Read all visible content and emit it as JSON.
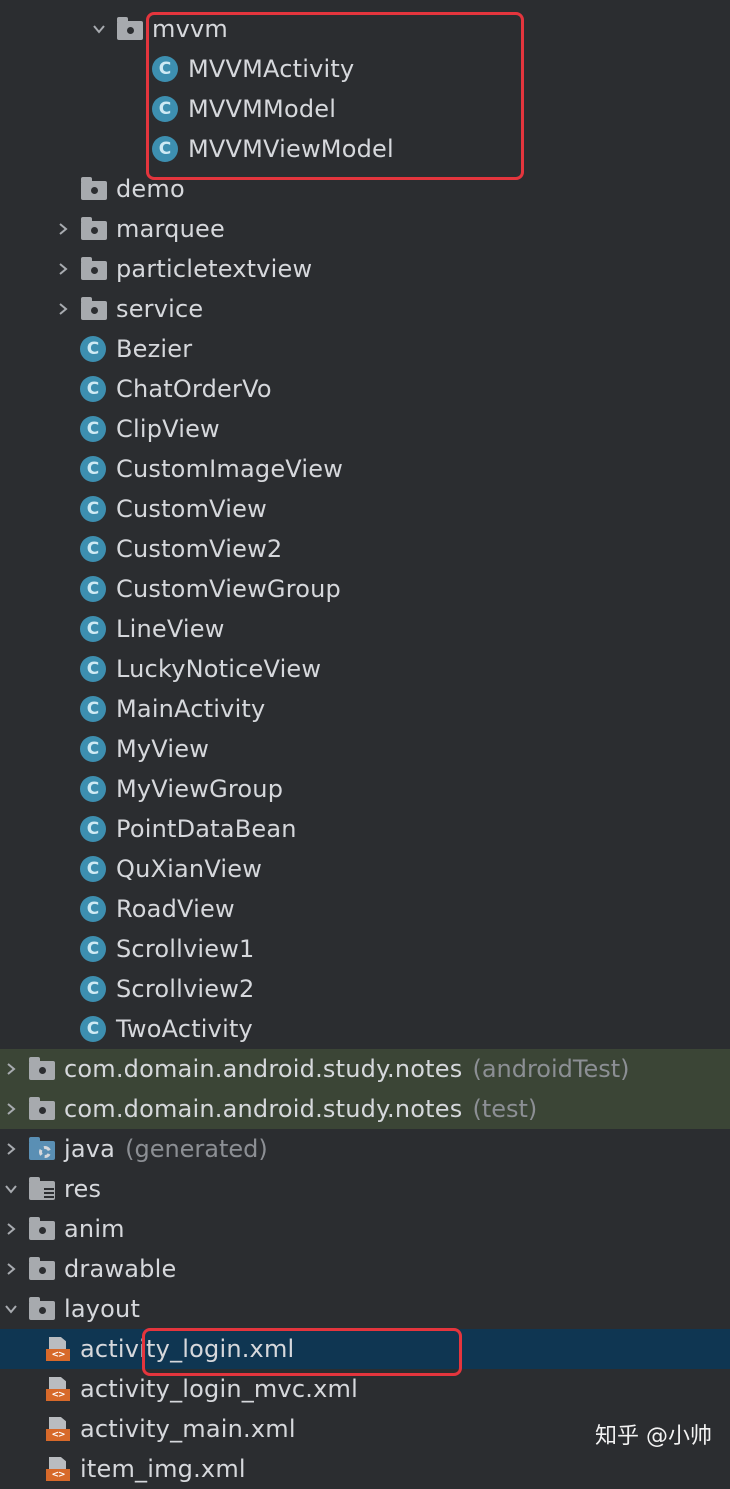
{
  "tree": {
    "rows": [
      {
        "label": "mvvm",
        "suffix": "",
        "icon": "folder",
        "arrow": "down",
        "depth": 6,
        "style": ""
      },
      {
        "label": "MVVMActivity",
        "suffix": "",
        "icon": "class",
        "arrow": "none",
        "depth": 7,
        "style": ""
      },
      {
        "label": "MVVMModel",
        "suffix": "",
        "icon": "class",
        "arrow": "none",
        "depth": 7,
        "style": ""
      },
      {
        "label": "MVVMViewModel",
        "suffix": "",
        "icon": "class",
        "arrow": "none",
        "depth": 7,
        "style": ""
      },
      {
        "label": "demo",
        "suffix": "",
        "icon": "folder",
        "arrow": "none",
        "depth": 5,
        "style": ""
      },
      {
        "label": "marquee",
        "suffix": "",
        "icon": "folder",
        "arrow": "right",
        "depth": 5,
        "style": ""
      },
      {
        "label": "particletextview",
        "suffix": "",
        "icon": "folder",
        "arrow": "right",
        "depth": 5,
        "style": ""
      },
      {
        "label": "service",
        "suffix": "",
        "icon": "folder",
        "arrow": "right",
        "depth": 5,
        "style": ""
      },
      {
        "label": "Bezier",
        "suffix": "",
        "icon": "class",
        "arrow": "none",
        "depth": 5,
        "style": ""
      },
      {
        "label": "ChatOrderVo",
        "suffix": "",
        "icon": "class",
        "arrow": "none",
        "depth": 5,
        "style": ""
      },
      {
        "label": "ClipView",
        "suffix": "",
        "icon": "class",
        "arrow": "none",
        "depth": 5,
        "style": ""
      },
      {
        "label": "CustomImageView",
        "suffix": "",
        "icon": "class",
        "arrow": "none",
        "depth": 5,
        "style": ""
      },
      {
        "label": "CustomView",
        "suffix": "",
        "icon": "class",
        "arrow": "none",
        "depth": 5,
        "style": ""
      },
      {
        "label": "CustomView2",
        "suffix": "",
        "icon": "class",
        "arrow": "none",
        "depth": 5,
        "style": ""
      },
      {
        "label": "CustomViewGroup",
        "suffix": "",
        "icon": "class",
        "arrow": "none",
        "depth": 5,
        "style": ""
      },
      {
        "label": "LineView",
        "suffix": "",
        "icon": "class",
        "arrow": "none",
        "depth": 5,
        "style": ""
      },
      {
        "label": "LuckyNoticeView",
        "suffix": "",
        "icon": "class",
        "arrow": "none",
        "depth": 5,
        "style": ""
      },
      {
        "label": "MainActivity",
        "suffix": "",
        "icon": "class",
        "arrow": "none",
        "depth": 5,
        "style": ""
      },
      {
        "label": "MyView",
        "suffix": "",
        "icon": "class",
        "arrow": "none",
        "depth": 5,
        "style": ""
      },
      {
        "label": "MyViewGroup",
        "suffix": "",
        "icon": "class",
        "arrow": "none",
        "depth": 5,
        "style": ""
      },
      {
        "label": "PointDataBean",
        "suffix": "",
        "icon": "class",
        "arrow": "none",
        "depth": 5,
        "style": ""
      },
      {
        "label": "QuXianView",
        "suffix": "",
        "icon": "class",
        "arrow": "none",
        "depth": 5,
        "style": ""
      },
      {
        "label": "RoadView",
        "suffix": "",
        "icon": "class",
        "arrow": "none",
        "depth": 5,
        "style": ""
      },
      {
        "label": "Scrollview1",
        "suffix": "",
        "icon": "class",
        "arrow": "none",
        "depth": 5,
        "style": ""
      },
      {
        "label": "Scrollview2",
        "suffix": "",
        "icon": "class",
        "arrow": "none",
        "depth": 5,
        "style": ""
      },
      {
        "label": "TwoActivity",
        "suffix": "",
        "icon": "class",
        "arrow": "none",
        "depth": 5,
        "style": ""
      },
      {
        "label": "com.domain.android.study.notes",
        "suffix": "(androidTest)",
        "icon": "folder",
        "arrow": "right",
        "depth": 3,
        "style": "green"
      },
      {
        "label": "com.domain.android.study.notes",
        "suffix": "(test)",
        "icon": "folder",
        "arrow": "right",
        "depth": 3,
        "style": "green"
      },
      {
        "label": "java",
        "suffix": "(generated)",
        "icon": "genfolder",
        "arrow": "right",
        "depth": 2,
        "style": ""
      },
      {
        "label": "res",
        "suffix": "",
        "icon": "resfolder",
        "arrow": "down",
        "depth": 2,
        "style": ""
      },
      {
        "label": "anim",
        "suffix": "",
        "icon": "folder",
        "arrow": "right",
        "depth": 3,
        "style": ""
      },
      {
        "label": "drawable",
        "suffix": "",
        "icon": "folder",
        "arrow": "right",
        "depth": 3,
        "style": ""
      },
      {
        "label": "layout",
        "suffix": "",
        "icon": "folder",
        "arrow": "down",
        "depth": 3,
        "style": ""
      },
      {
        "label": "activity_login.xml",
        "suffix": "",
        "icon": "xml",
        "arrow": "none",
        "depth": 4,
        "style": "selected"
      },
      {
        "label": "activity_login_mvc.xml",
        "suffix": "",
        "icon": "xml",
        "arrow": "none",
        "depth": 4,
        "style": ""
      },
      {
        "label": "activity_main.xml",
        "suffix": "",
        "icon": "xml",
        "arrow": "none",
        "depth": 4,
        "style": ""
      },
      {
        "label": "item_img.xml",
        "suffix": "",
        "icon": "xml",
        "arrow": "none",
        "depth": 4,
        "style": ""
      }
    ]
  },
  "icons": {
    "class_letter": "C",
    "xml_tag": "<>"
  },
  "colors": {
    "background": "#2b2d30",
    "selected_row": "#0f3652",
    "test_source_row": "#3b4536",
    "class_icon": "#3d8fb0",
    "xml_icon": "#d7692a",
    "highlight_box": "#e4353d"
  },
  "watermark": "知乎 @小帅"
}
